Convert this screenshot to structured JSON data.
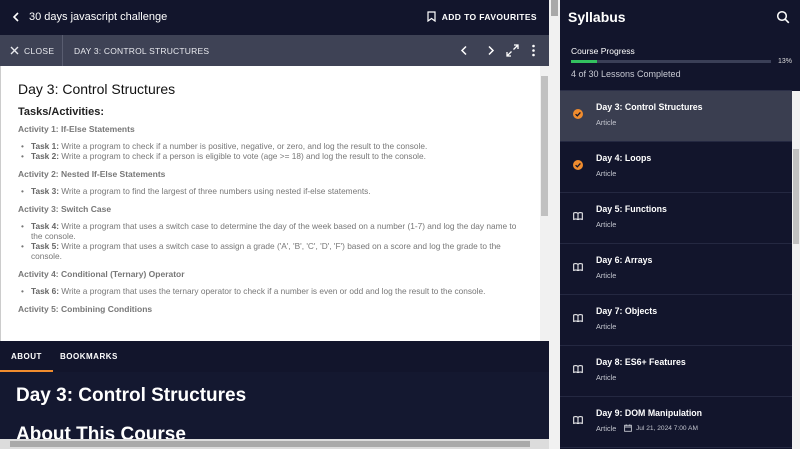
{
  "topbar": {
    "title": "30 days javascript challenge",
    "favourite_label": "ADD TO FAVOURITES"
  },
  "viewer": {
    "close_label": "CLOSE",
    "lesson_title": "DAY 3: CONTROL STRUCTURES"
  },
  "document": {
    "title": "Day 3: Control Structures",
    "subtitle": "Tasks/Activities:",
    "activities": [
      {
        "heading": "Activity 1: If-Else Statements",
        "tasks": [
          {
            "label": "Task 1:",
            "text": " Write a program to check if a number is positive, negative, or zero, and log the result to the console."
          },
          {
            "label": "Task 2:",
            "text": " Write a program to check if a person is eligible to vote (age >= 18) and log the result to the console."
          }
        ]
      },
      {
        "heading": "Activity 2: Nested If-Else Statements",
        "tasks": [
          {
            "label": "Task 3:",
            "text": " Write a program to find the largest of three numbers using nested if-else statements."
          }
        ]
      },
      {
        "heading": "Activity 3: Switch Case",
        "tasks": [
          {
            "label": "Task 4:",
            "text": " Write a program that uses a switch case to determine the day of the week based on a number (1-7) and log the day name to the console."
          },
          {
            "label": "Task 5:",
            "text": " Write a program that uses a switch case to assign a grade ('A', 'B', 'C', 'D', 'F') based on a score and log the grade to the console."
          }
        ]
      },
      {
        "heading": "Activity 4: Conditional (Ternary) Operator",
        "tasks": [
          {
            "label": "Task 6:",
            "text": " Write a program that uses the ternary operator to check if a number is even or odd and log the result to the console."
          }
        ]
      },
      {
        "heading": "Activity 5: Combining Conditions",
        "tasks": []
      }
    ]
  },
  "tabs": [
    {
      "label": "ABOUT",
      "active": true
    },
    {
      "label": "BOOKMARKS",
      "active": false
    }
  ],
  "about": {
    "heading": "Day 3: Control Structures",
    "course_heading": "About This Course"
  },
  "syllabus": {
    "title": "Syllabus",
    "progress_label": "Course Progress",
    "progress_percent_text": "13%",
    "progress_fraction": 0.13,
    "completed_text": "4 of 30 Lessons Completed",
    "accent_color": "#f08c2e",
    "progress_color": "#33c15f",
    "lessons": [
      {
        "name": "Day 3: Control Structures",
        "type": "Article",
        "status": "complete",
        "icon": "check-circle-icon",
        "active": true
      },
      {
        "name": "Day 4: Loops",
        "type": "Article",
        "status": "complete",
        "icon": "check-circle-icon",
        "active": false
      },
      {
        "name": "Day 5: Functions",
        "type": "Article",
        "status": "pending",
        "icon": "book-icon",
        "active": false
      },
      {
        "name": "Day 6: Arrays",
        "type": "Article",
        "status": "pending",
        "icon": "book-icon",
        "active": false
      },
      {
        "name": "Day 7: Objects",
        "type": "Article",
        "status": "pending",
        "icon": "book-icon",
        "active": false
      },
      {
        "name": "Day 8: ES6+ Features",
        "type": "Article",
        "status": "pending",
        "icon": "book-icon",
        "active": false
      },
      {
        "name": "Day 9: DOM Manipulation",
        "type": "Article",
        "status": "pending",
        "icon": "book-icon",
        "active": false,
        "date": "Jul 21, 2024 7:00 AM"
      }
    ]
  }
}
